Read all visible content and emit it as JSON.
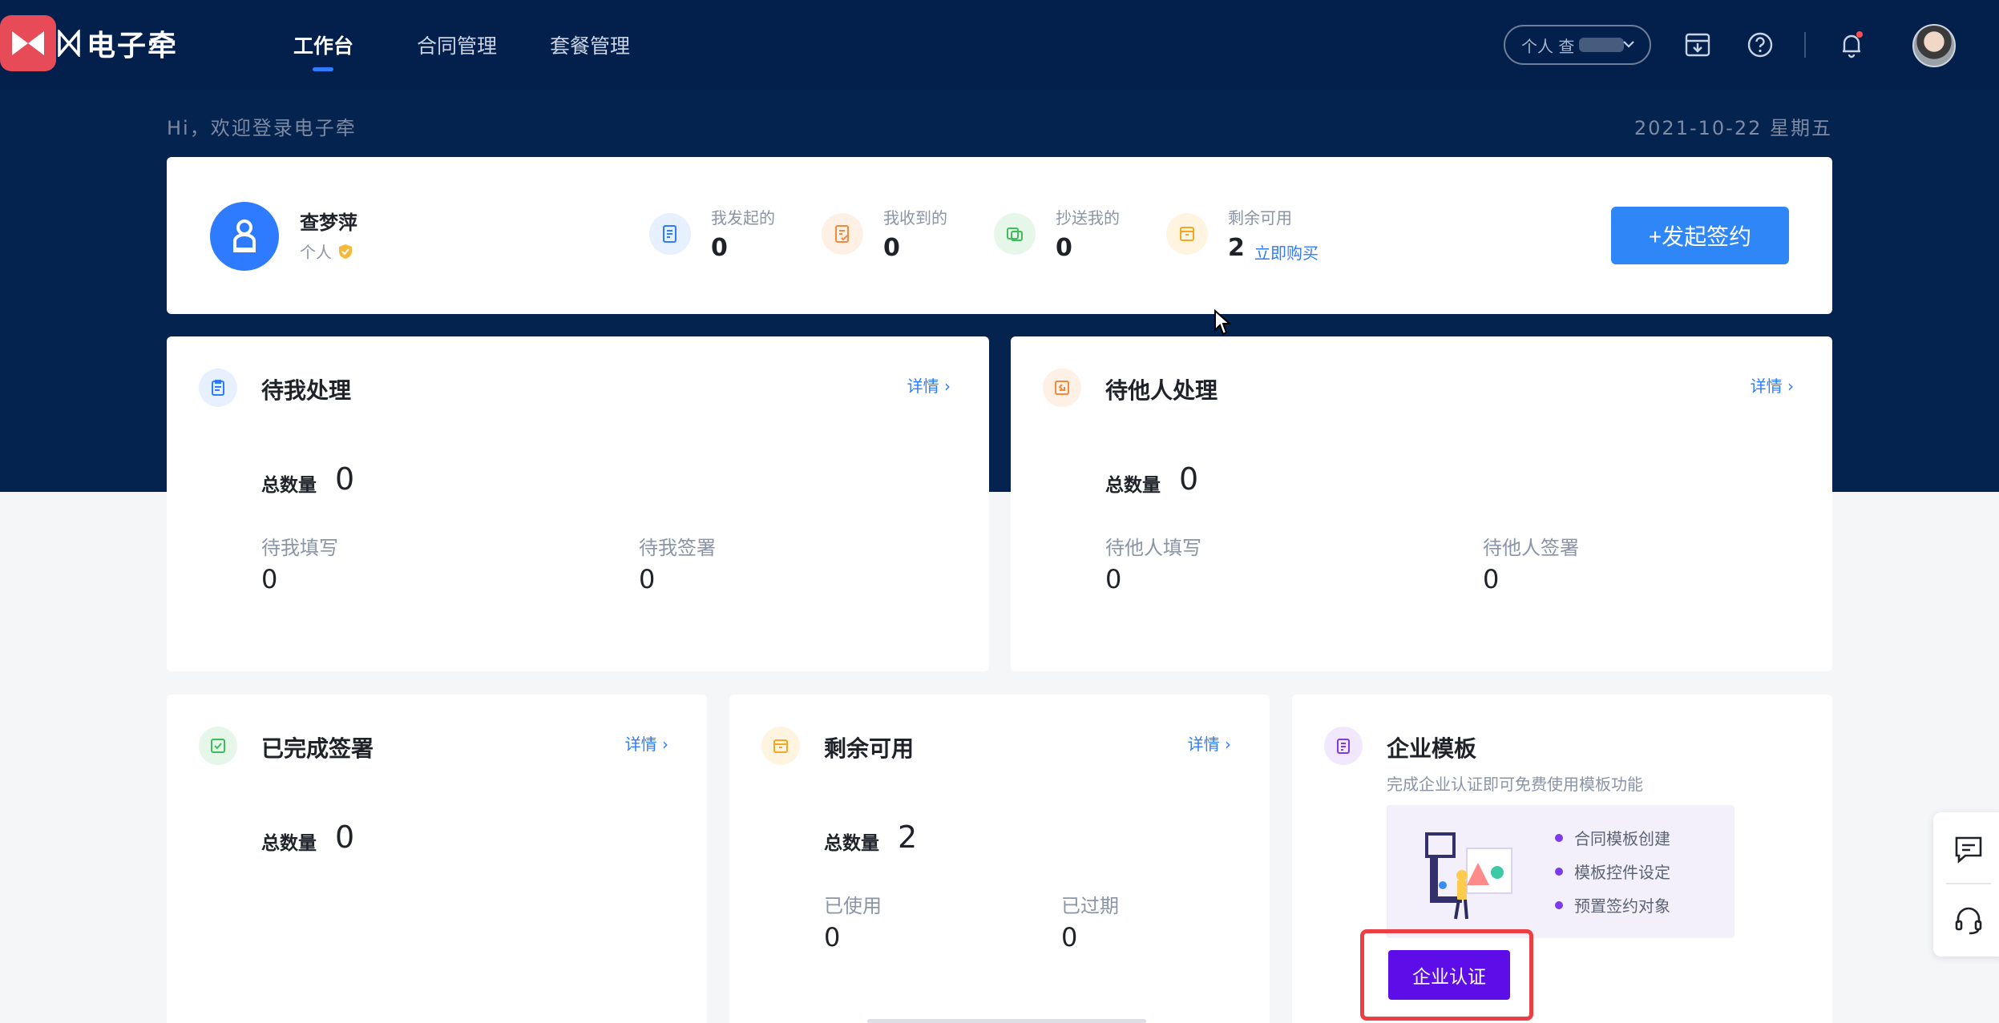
{
  "app": {
    "name": "电子牵",
    "colors": {
      "navy": "#05234f",
      "accent": "#2f7bff",
      "purple": "#5d0ee8",
      "highlight": "#ec3f45"
    }
  },
  "nav": {
    "tabs": [
      {
        "label": "工作台",
        "active": true
      },
      {
        "label": "合同管理",
        "active": false
      },
      {
        "label": "套餐管理",
        "active": false
      }
    ],
    "account_select": {
      "value": "个人 查"
    },
    "icons": [
      "download-box-icon",
      "help-icon",
      "bell-icon",
      "user-avatar"
    ]
  },
  "header": {
    "greeting": "Hi，欢迎登录电子牵",
    "date": "2021-10-22 星期五"
  },
  "profile": {
    "name": "查梦萍",
    "type": "个人",
    "stats": [
      {
        "label": "我发起的",
        "value": "0"
      },
      {
        "label": "我收到的",
        "value": "0"
      },
      {
        "label": "抄送我的",
        "value": "0"
      },
      {
        "label": "剩余可用",
        "value": "2",
        "link": "立即购买"
      }
    ],
    "start_button": "+发起签约"
  },
  "cards": {
    "pending_me": {
      "title": "待我处理",
      "more": "详情 ›",
      "total_label": "总数量",
      "total": "0",
      "sub": [
        {
          "label": "待我填写",
          "value": "0"
        },
        {
          "label": "待我签署",
          "value": "0"
        }
      ]
    },
    "pending_others": {
      "title": "待他人处理",
      "more": "详情 ›",
      "total_label": "总数量",
      "total": "0",
      "sub": [
        {
          "label": "待他人填写",
          "value": "0"
        },
        {
          "label": "待他人签署",
          "value": "0"
        }
      ]
    },
    "completed": {
      "title": "已完成签署",
      "more": "详情 ›",
      "total_label": "总数量",
      "total": "0"
    },
    "remaining": {
      "title": "剩余可用",
      "more": "详情 ›",
      "total_label": "总数量",
      "total": "2",
      "sub": [
        {
          "label": "已使用",
          "value": "0"
        },
        {
          "label": "已过期",
          "value": "0"
        }
      ]
    },
    "template": {
      "title": "企业模板",
      "desc": "完成企业认证即可免费使用模板功能",
      "features": [
        "合同模板创建",
        "模板控件设定",
        "预置签约对象"
      ],
      "button": "企业认证"
    }
  }
}
